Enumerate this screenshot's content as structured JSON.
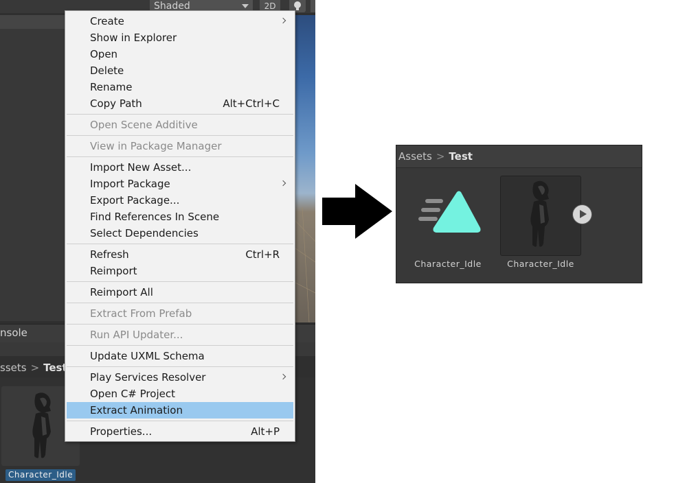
{
  "scene_toolbar": {
    "shading_mode": "Shaded",
    "toggle_2d": "2D",
    "light_toggle_icon": "lightbulb-icon"
  },
  "console_tab": {
    "label": "nsole"
  },
  "project_left": {
    "breadcrumb": {
      "root": "ssets",
      "current": "Test"
    },
    "selected_asset": {
      "name": "Character_Idle"
    }
  },
  "context_menu": {
    "items": [
      {
        "label": "Create",
        "shortcut": "",
        "submenu": true,
        "disabled": false,
        "highlighted": false
      },
      {
        "label": "Show in Explorer",
        "shortcut": "",
        "submenu": false,
        "disabled": false,
        "highlighted": false
      },
      {
        "label": "Open",
        "shortcut": "",
        "submenu": false,
        "disabled": false,
        "highlighted": false
      },
      {
        "label": "Delete",
        "shortcut": "",
        "submenu": false,
        "disabled": false,
        "highlighted": false
      },
      {
        "label": "Rename",
        "shortcut": "",
        "submenu": false,
        "disabled": false,
        "highlighted": false
      },
      {
        "label": "Copy Path",
        "shortcut": "Alt+Ctrl+C",
        "submenu": false,
        "disabled": false,
        "highlighted": false
      },
      {
        "label": "Open Scene Additive",
        "shortcut": "",
        "submenu": false,
        "disabled": true,
        "highlighted": false
      },
      {
        "label": "View in Package Manager",
        "shortcut": "",
        "submenu": false,
        "disabled": true,
        "highlighted": false
      },
      {
        "label": "Import New Asset...",
        "shortcut": "",
        "submenu": false,
        "disabled": false,
        "highlighted": false
      },
      {
        "label": "Import Package",
        "shortcut": "",
        "submenu": true,
        "disabled": false,
        "highlighted": false
      },
      {
        "label": "Export Package...",
        "shortcut": "",
        "submenu": false,
        "disabled": false,
        "highlighted": false
      },
      {
        "label": "Find References In Scene",
        "shortcut": "",
        "submenu": false,
        "disabled": false,
        "highlighted": false
      },
      {
        "label": "Select Dependencies",
        "shortcut": "",
        "submenu": false,
        "disabled": false,
        "highlighted": false
      },
      {
        "label": "Refresh",
        "shortcut": "Ctrl+R",
        "submenu": false,
        "disabled": false,
        "highlighted": false
      },
      {
        "label": "Reimport",
        "shortcut": "",
        "submenu": false,
        "disabled": false,
        "highlighted": false
      },
      {
        "label": "Reimport All",
        "shortcut": "",
        "submenu": false,
        "disabled": false,
        "highlighted": false
      },
      {
        "label": "Extract From Prefab",
        "shortcut": "",
        "submenu": false,
        "disabled": true,
        "highlighted": false
      },
      {
        "label": "Run API Updater...",
        "shortcut": "",
        "submenu": false,
        "disabled": true,
        "highlighted": false
      },
      {
        "label": "Update UXML Schema",
        "shortcut": "",
        "submenu": false,
        "disabled": false,
        "highlighted": false
      },
      {
        "label": "Play Services Resolver",
        "shortcut": "",
        "submenu": true,
        "disabled": false,
        "highlighted": false
      },
      {
        "label": "Open C# Project",
        "shortcut": "",
        "submenu": false,
        "disabled": false,
        "highlighted": false
      },
      {
        "label": "Extract Animation",
        "shortcut": "",
        "submenu": false,
        "disabled": false,
        "highlighted": true
      },
      {
        "label": "Properties...",
        "shortcut": "Alt+P",
        "submenu": false,
        "disabled": false,
        "highlighted": false
      }
    ]
  },
  "result_panel": {
    "breadcrumb": {
      "root": "Assets",
      "current": "Test"
    },
    "assets": [
      {
        "name": "Character_Idle",
        "icon": "animation-clip-icon"
      },
      {
        "name": "Character_Idle",
        "icon": "character-model-icon"
      }
    ]
  },
  "colors": {
    "menu_highlight": "#99c9ef",
    "animation_clip_accent": "#74f2e0",
    "selection_label": "#2c5d87",
    "editor_dark": "#383838"
  }
}
